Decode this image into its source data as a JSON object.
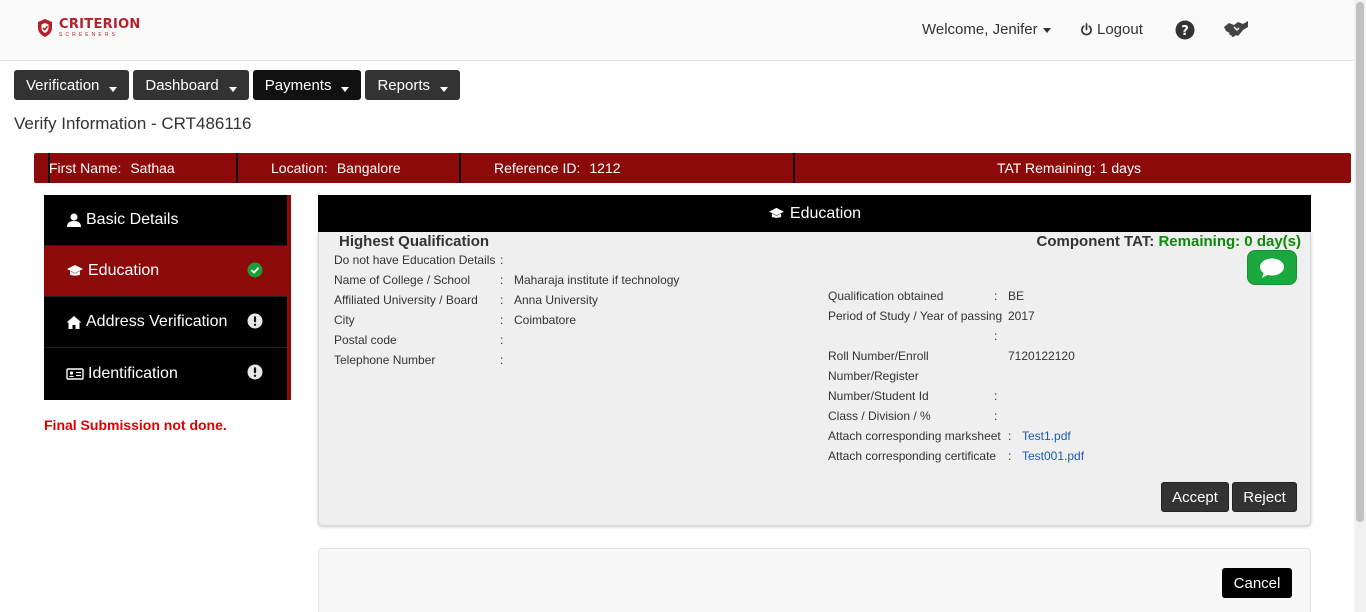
{
  "brand": {
    "name": "CRITERION",
    "tagline": "SCREENERS",
    "color": "#b3222a"
  },
  "header": {
    "welcome": "Welcome, Jenifer",
    "logout": "Logout",
    "icons": [
      "question-circle-icon",
      "handshake-icon"
    ]
  },
  "nav": {
    "items": [
      {
        "label": "Verification"
      },
      {
        "label": "Dashboard"
      },
      {
        "label": "Payments"
      },
      {
        "label": "Reports"
      }
    ]
  },
  "page": {
    "title": "Verify Information - CRT486116"
  },
  "infobar": {
    "first_name_label": "First Name:",
    "first_name": "Sathaa",
    "location_label": "Location:",
    "location": "Bangalore",
    "reference_label": "Reference ID:",
    "reference": "1212",
    "tat": "TAT Remaining: 1 days",
    "color": "#8c0a0a"
  },
  "sidebar": {
    "items": [
      {
        "label": "Basic Details",
        "icon": "user-icon",
        "status": ""
      },
      {
        "label": "Education",
        "icon": "graduation-cap-icon",
        "status": "complete"
      },
      {
        "label": "Address Verification",
        "icon": "home-icon",
        "status": "pending"
      },
      {
        "label": "Identification",
        "icon": "id-card-icon",
        "status": "pending"
      }
    ],
    "final_message": "Final Submission not done."
  },
  "education": {
    "header": "Education",
    "section_title": "Highest Qualification",
    "component_tat_label": "Component TAT:",
    "component_tat_value": "Remaining: 0 day(s)",
    "left_fields": [
      {
        "label": "Do not have Education Details",
        "value": ""
      },
      {
        "label": "Name of College / School",
        "value": "Maharaja institute if technology"
      },
      {
        "label": "Affiliated University / Board",
        "value": "Anna University"
      },
      {
        "label": "City",
        "value": "Coimbatore"
      },
      {
        "label": "Postal code",
        "value": ""
      },
      {
        "label": "Telephone Number",
        "value": ""
      }
    ],
    "right_fields": {
      "qualification_label": "Qualification obtained",
      "qualification": "BE",
      "period_label": "Period of Study / Year of passing",
      "period": "2017",
      "roll_label_1": "Roll Number/Enroll",
      "roll_label_2": "Number/Register",
      "roll_label_3": "Number/Student Id",
      "roll": "7120122120",
      "class_label": "Class / Division / %",
      "class": "",
      "marksheet_label": "Attach corresponding marksheet",
      "marksheet": "Test1.pdf",
      "certificate_label": "Attach corresponding certificate",
      "certificate": "Test001.pdf"
    },
    "accept": "Accept",
    "reject": "Reject"
  },
  "footer": {
    "cancel": "Cancel"
  }
}
